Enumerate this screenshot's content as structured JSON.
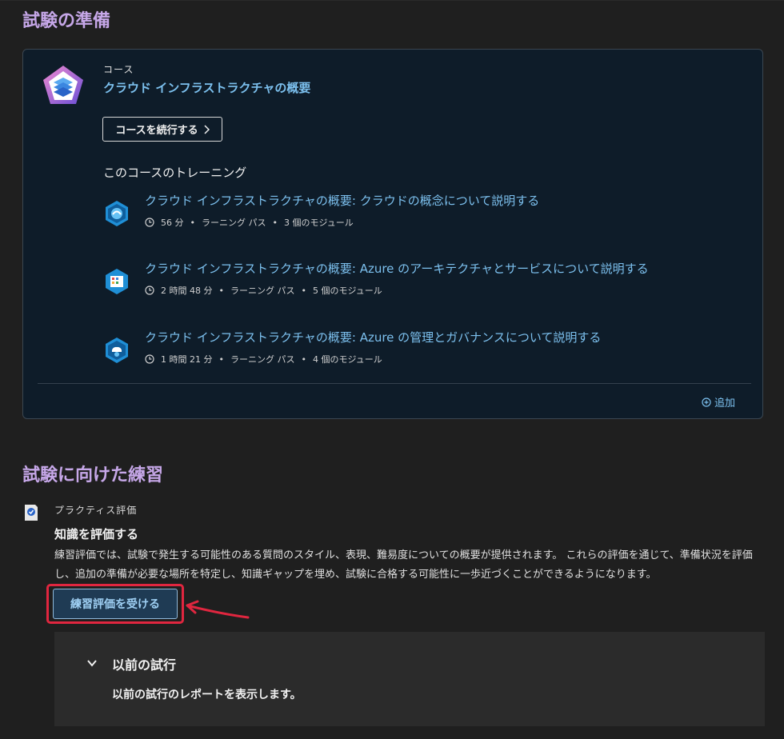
{
  "prep_section": {
    "title": "試験の準備"
  },
  "course": {
    "kicker": "コース",
    "title": "クラウド インフラストラクチャの概要",
    "continue_label": "コースを続行する",
    "training_heading": "このコースのトレーニング",
    "add_label": "追加",
    "learning_paths": [
      {
        "title": "クラウド インフラストラクチャの概要: クラウドの概念について説明する",
        "duration": "56 分",
        "type": "ラーニング パス",
        "modules": "3 個のモジュール",
        "icon": "cloud-concepts-icon"
      },
      {
        "title": "クラウド インフラストラクチャの概要: Azure のアーキテクチャとサービスについて説明する",
        "duration": "2 時間 48 分",
        "type": "ラーニング パス",
        "modules": "5 個のモジュール",
        "icon": "architecture-icon"
      },
      {
        "title": "クラウド インフラストラクチャの概要: Azure の管理とガバナンスについて説明する",
        "duration": "1 時間 21 分",
        "type": "ラーニング パス",
        "modules": "4 個のモジュール",
        "icon": "governance-icon"
      }
    ]
  },
  "practice_section": {
    "title": "試験に向けた練習",
    "kicker": "プラクティス評価",
    "heading": "知識を評価する",
    "description": "練習評価では、試験で発生する可能性のある質問のスタイル、表現、難易度についての概要が提供されます。 これらの評価を通じて、準備状況を評価し、追加の準備が必要な場所を特定し、知識ギャップを埋め、試験に合格する可能性に一歩近づくことができるようになります。",
    "button_label": "練習評価を受ける"
  },
  "previous_attempts": {
    "title": "以前の試行",
    "description": "以前の試行のレポートを表示します。"
  },
  "colors": {
    "accent_link": "#7cc0ee",
    "section_title": "#c6a7e8",
    "highlight": "#e0263f"
  }
}
